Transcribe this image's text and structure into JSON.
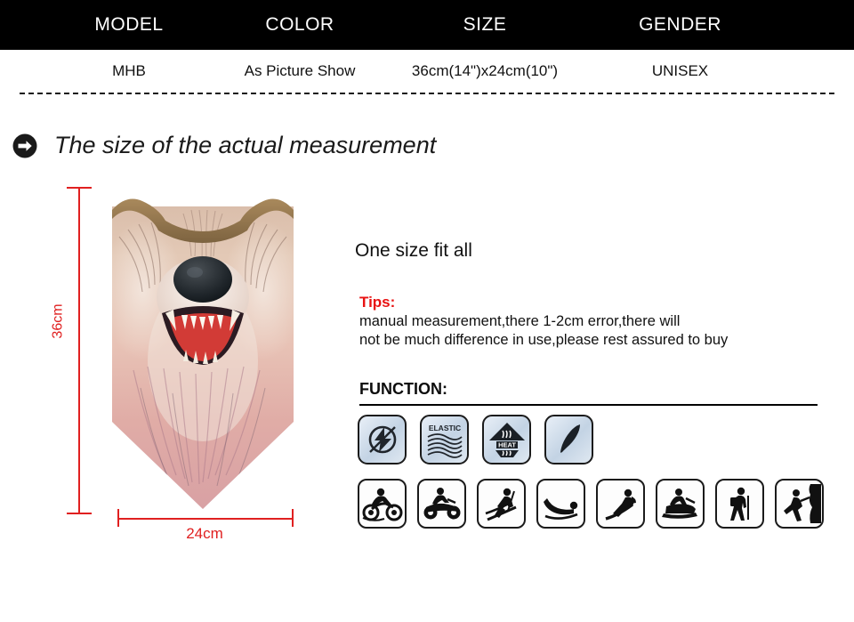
{
  "spec_table": {
    "headers": [
      "MODEL",
      "COLOR",
      "SIZE",
      "GENDER"
    ],
    "values": [
      "MHB",
      "As Picture Show",
      "36cm(14\")x24cm(10\")",
      "UNISEX"
    ]
  },
  "section": {
    "arrow_icon": "circle-arrow-right-icon",
    "title": "The size of the actual measurement"
  },
  "product": {
    "image_name": "wolf-face-triangle-neck-gaiter",
    "description": "Triangular bandana face mask printed with a snarling wolf face, brown binding at top"
  },
  "measurements": {
    "height_label": "36cm",
    "width_label": "24cm",
    "line_color": "#e02020"
  },
  "info": {
    "one_size": "One size fit all",
    "tips_title": "Tips:",
    "tips_line1": "manual measurement,there 1-2cm error,there will",
    "tips_line2": "not be much difference in use,please rest assured to buy",
    "tips_color": "#e81212",
    "function_label": "FUNCTION:"
  },
  "feature_icons": [
    {
      "name": "anti-static-icon",
      "label": ""
    },
    {
      "name": "elastic-icon",
      "label": "ELASTIC"
    },
    {
      "name": "heat-retention-icon",
      "label": "HEAT"
    },
    {
      "name": "lightweight-feather-icon",
      "label": ""
    }
  ],
  "sport_icons": [
    {
      "name": "motorcycle-icon"
    },
    {
      "name": "atv-quad-bike-icon"
    },
    {
      "name": "skiing-icon"
    },
    {
      "name": "sledding-icon"
    },
    {
      "name": "snowboarding-icon"
    },
    {
      "name": "snowmobile-icon"
    },
    {
      "name": "hiking-icon"
    },
    {
      "name": "rock-climbing-icon"
    }
  ]
}
